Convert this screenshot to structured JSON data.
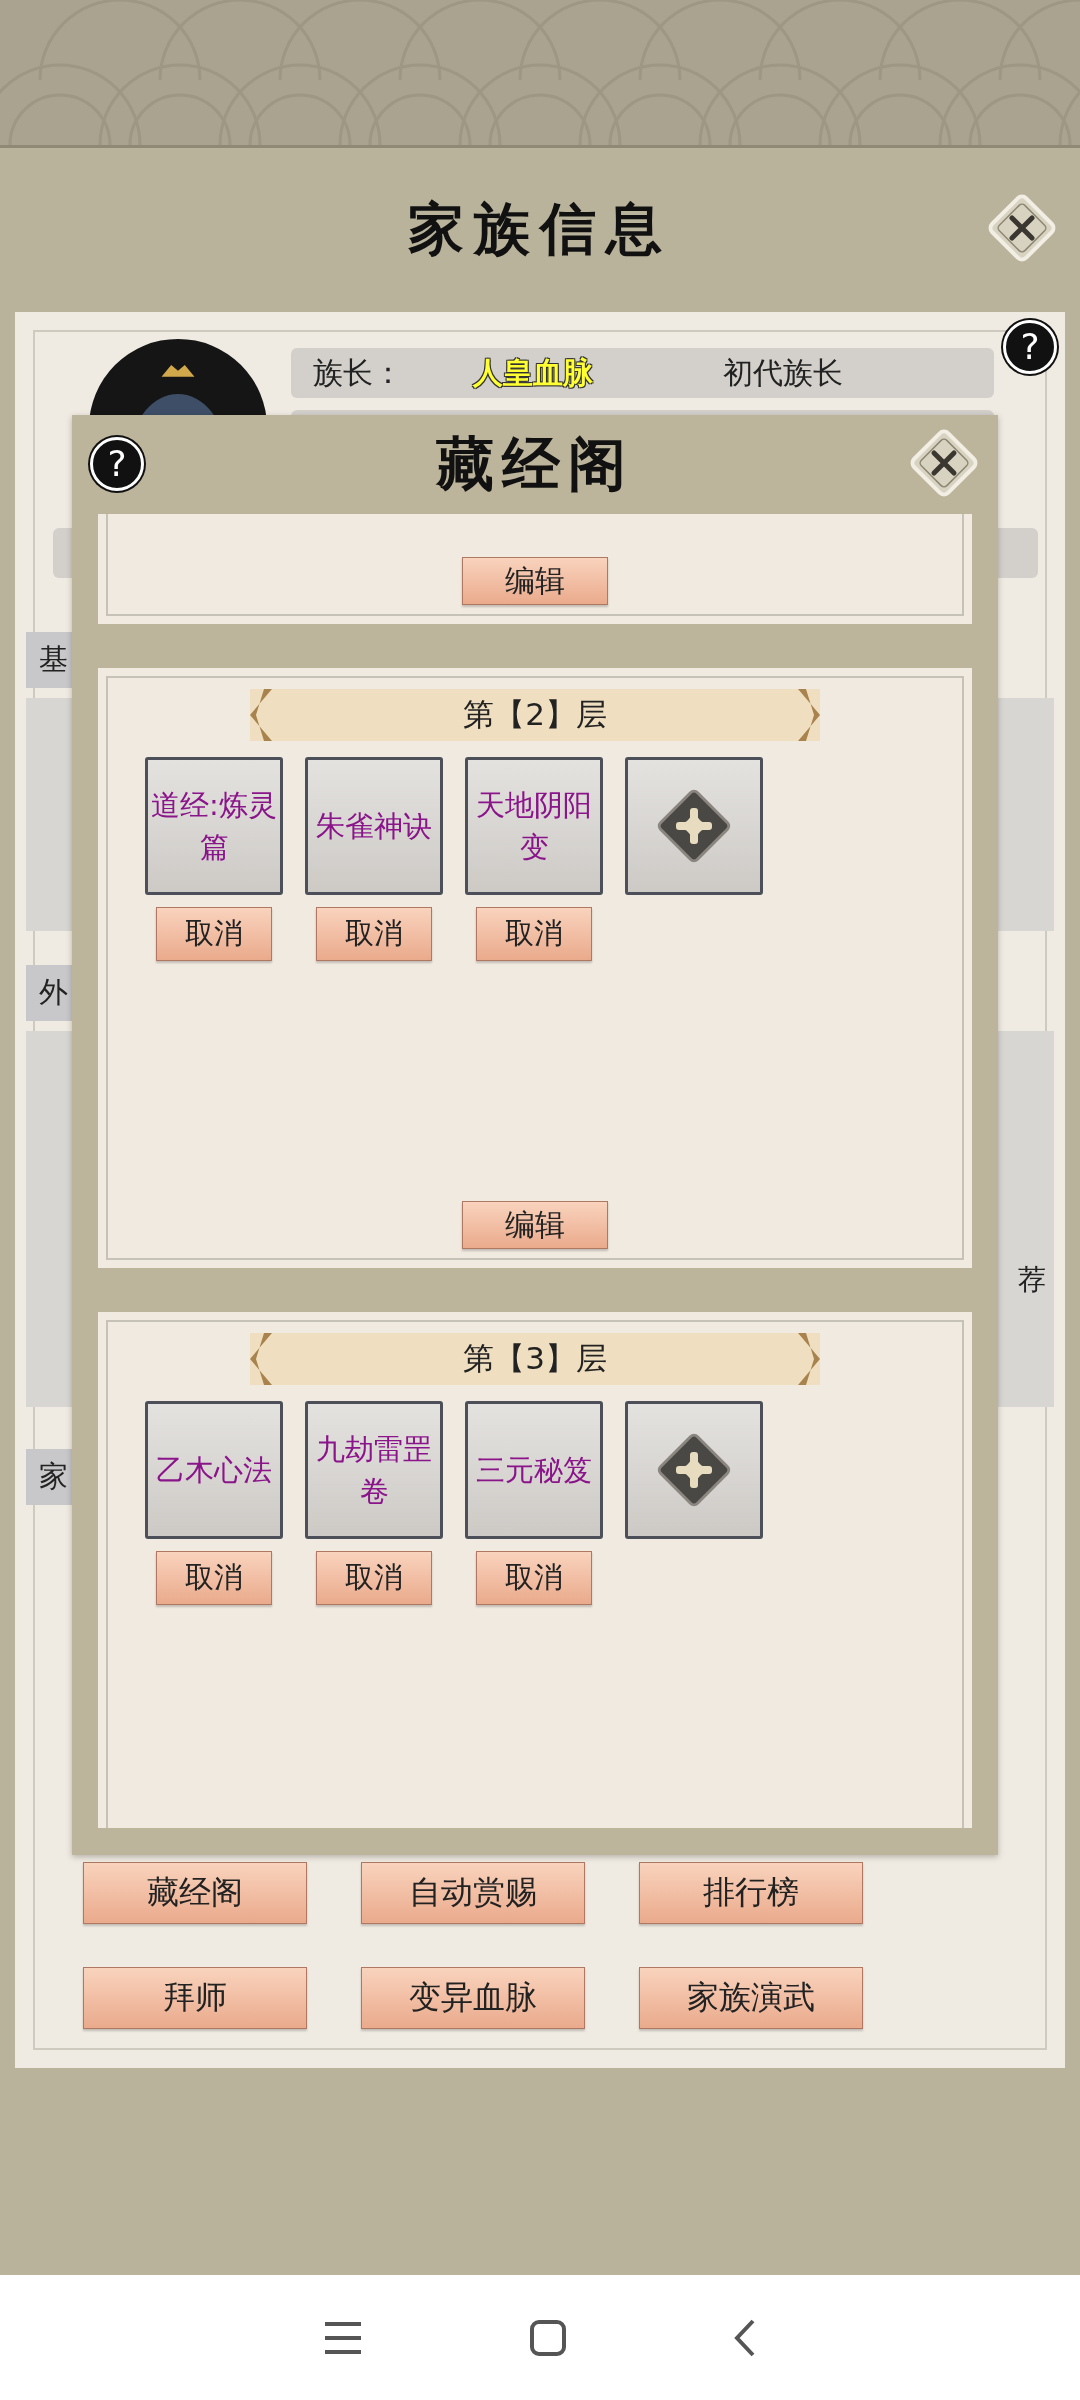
{
  "page": {
    "title": "家族信息",
    "help": "?"
  },
  "leader_row": {
    "label": "族长：",
    "bloodline": "人皇血脉",
    "rank": "初代族长"
  },
  "side_tabs": [
    {
      "label": "基"
    },
    {
      "label": "外"
    },
    {
      "label": "家"
    }
  ],
  "panel_text": "荐",
  "modal": {
    "title": "藏经阁",
    "help": "?",
    "shelves": [
      {
        "edit": "编辑"
      },
      {
        "heading": "第【2】层",
        "edit": "编辑",
        "slots": [
          {
            "kind": "book",
            "title": "道经:炼灵篇",
            "cancel": "取消"
          },
          {
            "kind": "book",
            "title": "朱雀神诀",
            "cancel": "取消"
          },
          {
            "kind": "book",
            "title": "天地阴阳变",
            "cancel": "取消"
          },
          {
            "kind": "add"
          }
        ]
      },
      {
        "heading": "第【3】层",
        "slots": [
          {
            "kind": "book",
            "title": "乙木心法",
            "cancel": "取消"
          },
          {
            "kind": "book",
            "title": "九劫雷罡卷",
            "cancel": "取消"
          },
          {
            "kind": "book",
            "title": "三元秘笈",
            "cancel": "取消"
          },
          {
            "kind": "add"
          }
        ]
      }
    ]
  },
  "bottom_buttons": [
    "藏经阁",
    "自动赏赐",
    "排行榜",
    "拜师",
    "变异血脉",
    "家族演武"
  ]
}
